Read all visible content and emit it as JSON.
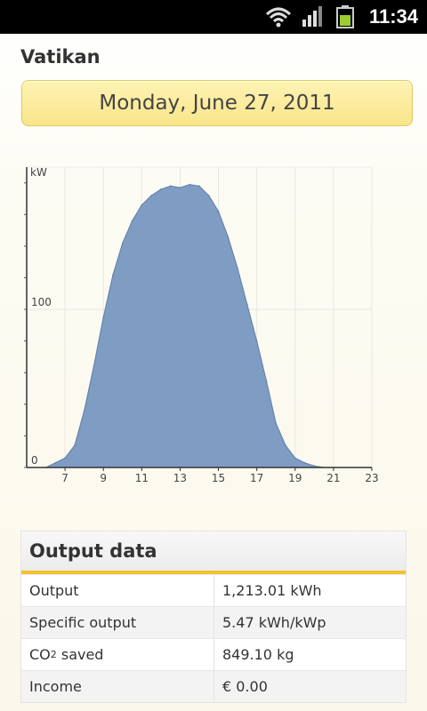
{
  "status_bar": {
    "time": "11:34",
    "icons": [
      "wifi-icon",
      "signal-icon",
      "battery-icon"
    ]
  },
  "plant_name": "Vatikan",
  "date": "Monday, June 27, 2011",
  "chart_data": {
    "type": "area",
    "ylabel": "kW",
    "x_ticks": [
      "7",
      "9",
      "11",
      "13",
      "15",
      "17",
      "19",
      "21",
      "23"
    ],
    "y_ticks": [
      "0",
      "100"
    ],
    "xlim": [
      5,
      23
    ],
    "ylim": [
      0,
      190
    ],
    "grid": true,
    "series": [
      {
        "color": "#7f9cc3",
        "x": [
          6.0,
          6.5,
          7.0,
          7.5,
          8.0,
          8.5,
          9.0,
          9.5,
          10.0,
          10.5,
          11.0,
          11.5,
          12.0,
          12.5,
          13.0,
          13.5,
          14.0,
          14.5,
          15.0,
          15.5,
          16.0,
          16.5,
          17.0,
          17.5,
          18.0,
          18.5,
          19.0,
          19.5,
          20.0,
          20.5
        ],
        "values": [
          0,
          3,
          6,
          14,
          36,
          64,
          95,
          122,
          142,
          156,
          166,
          172,
          176,
          178,
          177,
          179,
          178,
          172,
          162,
          146,
          126,
          103,
          80,
          55,
          28,
          14,
          6,
          3,
          1,
          0
        ]
      }
    ]
  },
  "output": {
    "title": "Output data",
    "rows": [
      {
        "label": "Output",
        "value": "1,213.01 kWh"
      },
      {
        "label": "Specific output",
        "value": "5.47 kWh/kWp"
      },
      {
        "label_main": "CO",
        "label_sub": "2",
        "label_rest": " saved",
        "value": "849.10 kg"
      },
      {
        "label": "Income",
        "value": "€ 0.00"
      }
    ]
  }
}
